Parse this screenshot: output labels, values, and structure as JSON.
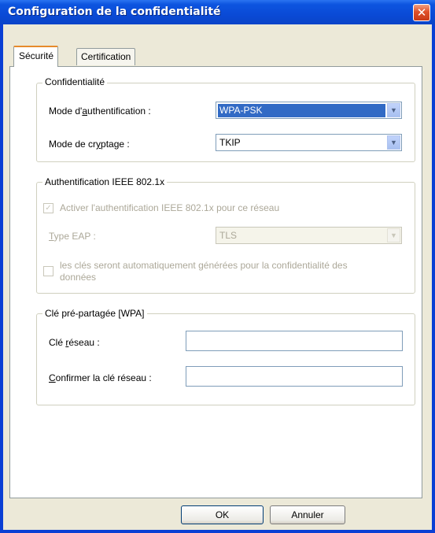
{
  "window": {
    "title": "Configuration de la confidentialité"
  },
  "tabs": [
    {
      "label": "Sécurité"
    },
    {
      "label": "Certification"
    }
  ],
  "confidentialite": {
    "legend": "Confidentialité",
    "auth_mode_label_pre": "Mode d'",
    "auth_mode_label_key": "a",
    "auth_mode_label_post": "uthentification :",
    "auth_mode_value": "WPA-PSK",
    "crypt_mode_label_pre": "Mode de cr",
    "crypt_mode_label_key": "y",
    "crypt_mode_label_post": "ptage :",
    "crypt_mode_value": "TKIP"
  },
  "ieee": {
    "legend": "Authentification IEEE 802.1x",
    "enable_label": "Activer l'authentification IEEE 802.1x pour ce réseau",
    "eap_label_key": "T",
    "eap_label_post": "ype EAP :",
    "eap_value": "TLS",
    "auto_keys_line1_pre": "les clés seront automatiquement ",
    "auto_keys_line1_key": "g",
    "auto_keys_line1_post": "énérées pour la confidentialité des",
    "auto_keys_line2": "données"
  },
  "psk": {
    "legend": "Clé pré-partagée [WPA]",
    "key_label_pre": "Clé ",
    "key_label_key": "r",
    "key_label_post": "éseau :",
    "key_value": "",
    "confirm_label_key": "C",
    "confirm_label_post": "onfirmer la clé réseau :",
    "confirm_value": ""
  },
  "buttons": {
    "ok": "OK",
    "cancel": "Annuler"
  },
  "colors": {
    "titlebar": "#0a4ad6",
    "selection": "#316ac5",
    "close": "#e0502a"
  }
}
